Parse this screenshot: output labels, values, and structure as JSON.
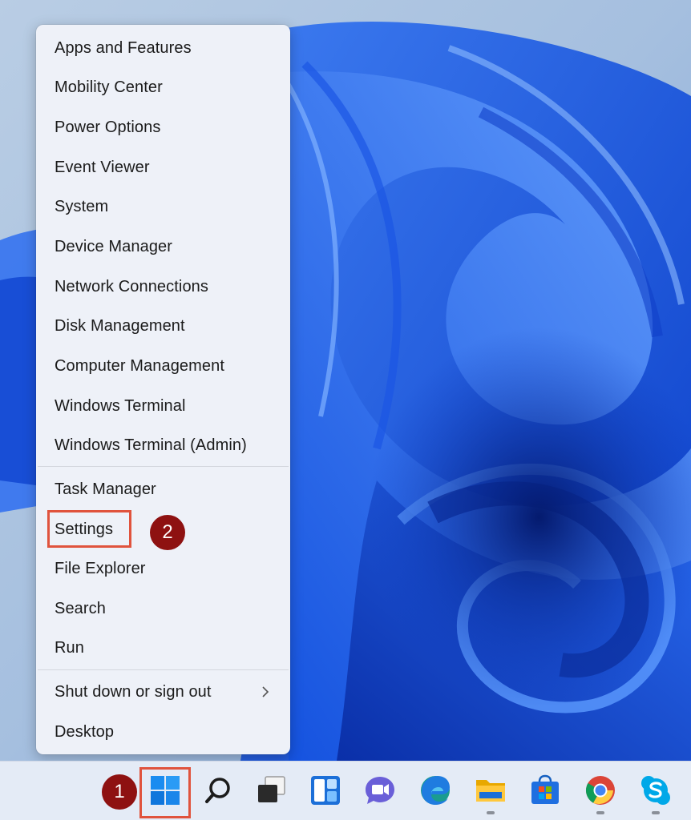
{
  "context_menu": {
    "items": [
      {
        "label": "Apps and Features"
      },
      {
        "label": "Mobility Center"
      },
      {
        "label": "Power Options"
      },
      {
        "label": "Event Viewer"
      },
      {
        "label": "System"
      },
      {
        "label": "Device Manager"
      },
      {
        "label": "Network Connections"
      },
      {
        "label": "Disk Management"
      },
      {
        "label": "Computer Management"
      },
      {
        "label": "Windows Terminal"
      },
      {
        "label": "Windows Terminal (Admin)"
      },
      {
        "label": "Task Manager"
      },
      {
        "label": "Settings"
      },
      {
        "label": "File Explorer"
      },
      {
        "label": "Search"
      },
      {
        "label": "Run"
      },
      {
        "label": "Shut down or sign out"
      },
      {
        "label": "Desktop"
      }
    ],
    "submenu_icon": "chevron-right-icon"
  },
  "annotations": {
    "step1": "1",
    "step2": "2",
    "color": "#8e1111",
    "highlight_color": "#e0533d"
  },
  "taskbar": {
    "icons": [
      "windows-start-icon",
      "search-icon",
      "task-view-icon",
      "widgets-icon",
      "teams-chat-icon",
      "edge-icon",
      "file-explorer-icon",
      "microsoft-store-icon",
      "chrome-icon",
      "skype-icon"
    ]
  }
}
